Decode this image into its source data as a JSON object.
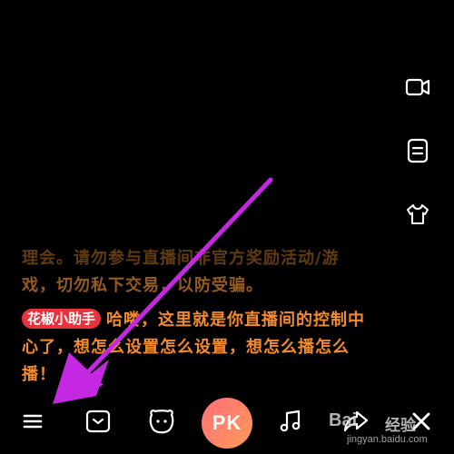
{
  "chat": {
    "notice_line_1": "理会。请勿参与直播间非官方奖励活动/游",
    "notice_line_2": "戏，切勿私下交易，以防受骗。",
    "helper_name": "花椒小助手",
    "helper_message": "哈喽，这里就是你直播间的控制中心了，想怎么设置怎么设置，想怎么播怎么播！"
  },
  "side_tools": [
    {
      "icon": "camera-icon"
    },
    {
      "icon": "note-icon"
    },
    {
      "icon": "outfit-icon"
    }
  ],
  "bottom_bar": {
    "pk_label": "PK",
    "icons": [
      "menu-icon",
      "inbox-icon",
      "bear-face-icon",
      "pk-button",
      "music-note-icon",
      "share-icon",
      "close-icon"
    ]
  },
  "colors": {
    "background": "#000000",
    "chat_text": "#f28a2e",
    "helper_badge": "#e8323c",
    "pk_gradient_start": "#ff6f7a",
    "pk_gradient_end": "#ff9a57",
    "arrow": "#c428e0"
  },
  "watermark": {
    "logo": "Bai",
    "brand": "经验",
    "url": "jingyan.baidu.com"
  }
}
